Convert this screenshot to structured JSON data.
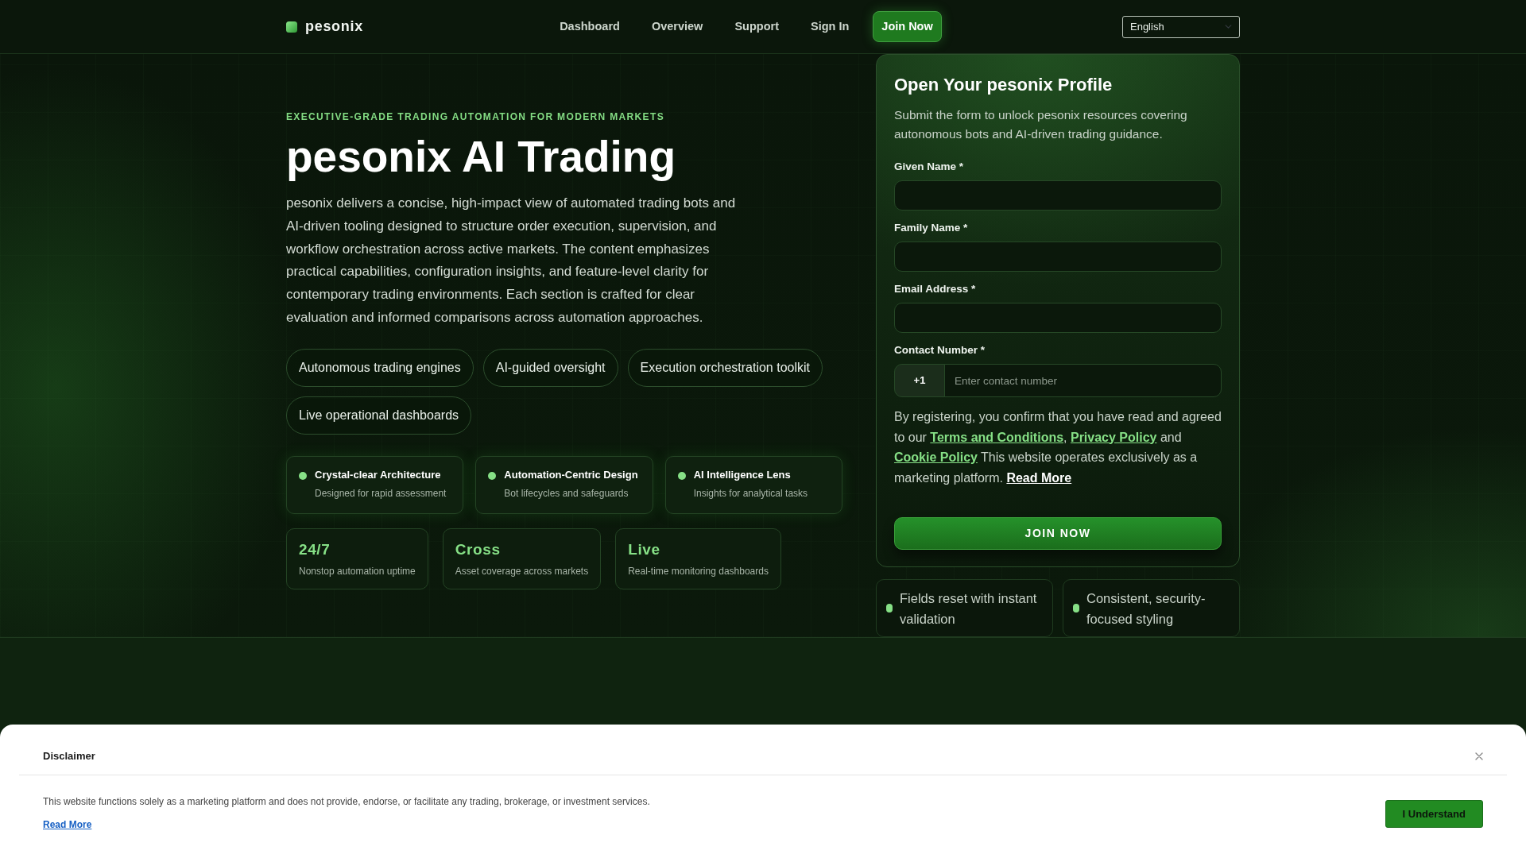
{
  "navbar": {
    "brand": "pesonix",
    "links": [
      "Dashboard",
      "Overview",
      "Support",
      "Sign In"
    ],
    "cta": "Join Now",
    "language": "English"
  },
  "hero": {
    "eyebrow": "EXECUTIVE-GRADE TRADING AUTOMATION FOR MODERN MARKETS",
    "title": "pesonix AI Trading",
    "description": "pesonix delivers a concise, high-impact view of automated trading bots and AI-driven tooling designed to structure order execution, supervision, and workflow orchestration across active markets. The content emphasizes practical capabilities, configuration insights, and feature-level clarity for contemporary trading environments. Each section is crafted for clear evaluation and informed comparisons across automation approaches.",
    "tags": [
      "Autonomous trading engines",
      "AI-guided oversight",
      "Execution orchestration toolkit",
      "Live operational dashboards"
    ],
    "features": [
      {
        "title": "Crystal-clear Architecture",
        "subtitle": "Designed for rapid assessment"
      },
      {
        "title": "Automation-Centric Design",
        "subtitle": "Bot lifecycles and safeguards"
      },
      {
        "title": "AI Intelligence Lens",
        "subtitle": "Insights for analytical tasks"
      }
    ],
    "stats": [
      {
        "value": "24/7",
        "label": "Nonstop automation uptime"
      },
      {
        "value": "Cross",
        "label": "Asset coverage across markets"
      },
      {
        "value": "Live",
        "label": "Real-time monitoring dashboards"
      }
    ]
  },
  "signup_form": {
    "title": "Open Your pesonix Profile",
    "subtitle": "Submit the form to unlock pesonix resources covering autonomous bots and AI-driven trading guidance.",
    "fields": [
      {
        "kind": "text",
        "label": "Given Name *"
      },
      {
        "kind": "text",
        "label": "Family Name *"
      },
      {
        "kind": "text",
        "label": "Email Address *"
      },
      {
        "kind": "phone",
        "label": "Contact Number *",
        "prefix": "+1",
        "placeholder": "Enter contact number"
      }
    ],
    "consent": [
      {
        "kind": "text",
        "text": "By registering, you confirm that you have read and agreed to our "
      },
      {
        "kind": "link",
        "text": "Terms and Conditions"
      },
      {
        "kind": "text",
        "text": ", "
      },
      {
        "kind": "link",
        "text": "Privacy Policy"
      },
      {
        "kind": "text",
        "text": " and "
      },
      {
        "kind": "link",
        "text": "Cookie Policy"
      },
      {
        "kind": "text",
        "text": " This website operates exclusively as a marketing platform. "
      },
      {
        "kind": "more_link",
        "text": "Read More"
      }
    ],
    "submit": "JOIN NOW"
  },
  "notes": [
    "Fields reset with instant validation",
    "Consistent, security-focused styling"
  ],
  "disclaimer": {
    "title": "Disclaimer",
    "text": "This website functions solely as a marketing platform and does not provide, endorse, or facilitate any trading, brokerage, or investment services.",
    "link": "Read More",
    "button": "I Understand"
  }
}
